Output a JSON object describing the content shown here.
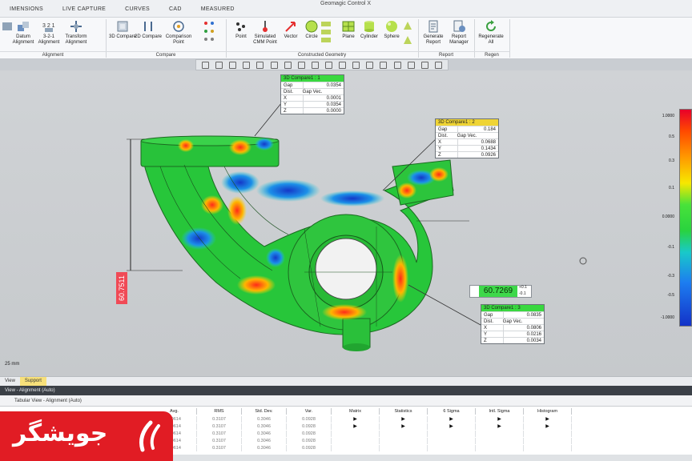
{
  "window": {
    "title": "Geomagic Control X"
  },
  "menu_tabs": [
    "IMENSIONS",
    "LIVE CAPTURE",
    "CURVES",
    "CAD",
    "MEASURED"
  ],
  "ribbon": {
    "groups": [
      {
        "name": "Alignment",
        "buttons": [
          "Datum Alignment",
          "3-2-1 Alignment",
          "Transform Alignment"
        ]
      },
      {
        "name": "Compare",
        "buttons": [
          "3D Compare",
          "2D Compare",
          "Comparison Point"
        ]
      },
      {
        "name": "Constructed Geometry",
        "buttons": [
          "Point",
          "Simulated CMM Point",
          "Vector",
          "Circle",
          "Plane",
          "Cylinder",
          "Sphere"
        ]
      },
      {
        "name": "Report",
        "buttons": [
          "Generate Report",
          "Report Manager"
        ]
      },
      {
        "name": "Regen",
        "buttons": [
          "Regenerate All"
        ]
      }
    ]
  },
  "callouts": [
    {
      "title": "3D Compare1 : 1",
      "color": "#39d83f",
      "gap_dist_label": "Gap Dist.",
      "gap_dist": "0.0354",
      "gap_vec_label": "Gap Vec.",
      "x_label": "X",
      "x": "0.0001",
      "y_label": "Y",
      "y": "0.0354",
      "z_label": "Z",
      "z": "0.0000"
    },
    {
      "title": "3D Compare1 : 2",
      "color": "#efd435",
      "gap_dist_label": "Gap Dist.",
      "gap_dist": "0.184",
      "gap_vec_label": "Gap Vec.",
      "x_label": "X",
      "x": "0.0688",
      "y_label": "Y",
      "y": "0.1434",
      "z_label": "Z",
      "z": "0.0926"
    },
    {
      "title": "3D Compare1 : 3",
      "color": "#39d83f",
      "gap_dist_label": "Gap Dist.",
      "gap_dist": "0.0835",
      "gap_vec_label": "Gap Vec.",
      "x_label": "X",
      "x": "0.0806",
      "y_label": "Y",
      "y": "0.0216",
      "z_label": "Z",
      "z": "0.0034"
    }
  ],
  "dimensions": {
    "diameter": "60.7269",
    "diameter_tol_upper": "+0.1",
    "diameter_tol_lower": "-0.1",
    "vertical": "60.7511"
  },
  "color_scale": [
    "1.0000",
    "0.5",
    "0.3",
    "0.1",
    "0.0000",
    "-0.1",
    "-0.3",
    "-0.5",
    "-1.0000"
  ],
  "scale_bar": "25 mm",
  "bottom_tabs": [
    "View",
    "Support"
  ],
  "panel_title": "View - Alignment (Auto)",
  "subpanel_title": "Tabular View - Alignment (Auto)",
  "table": {
    "headers": [
      "Avg.",
      "RMS",
      "Std. Dev.",
      "Var.",
      "Matrix",
      "Statistics",
      "6 Sigma",
      "Intl. Sigma",
      "Histogram"
    ],
    "rows": [
      [
        "0.0614",
        "0.3107",
        "0.3046",
        "0.0928",
        "▶",
        "▶",
        "▶",
        "▶",
        "▶"
      ],
      [
        "0.0614",
        "0.3107",
        "0.3046",
        "0.0928",
        "▶",
        "▶",
        "▶",
        "▶",
        "▶"
      ],
      [
        "0.0614",
        "0.3107",
        "0.3046",
        "0.0928",
        "",
        "",
        "",
        "",
        ""
      ],
      [
        "0.0614",
        "0.3107",
        "0.3046",
        "0.0928",
        "",
        "",
        "",
        "",
        ""
      ],
      [
        "0.0614",
        "0.3107",
        "0.3046",
        "0.0928",
        "",
        "",
        "",
        "",
        ""
      ]
    ]
  },
  "watermark": {
    "text": "جویشگر",
    "color": "#e11c24"
  }
}
